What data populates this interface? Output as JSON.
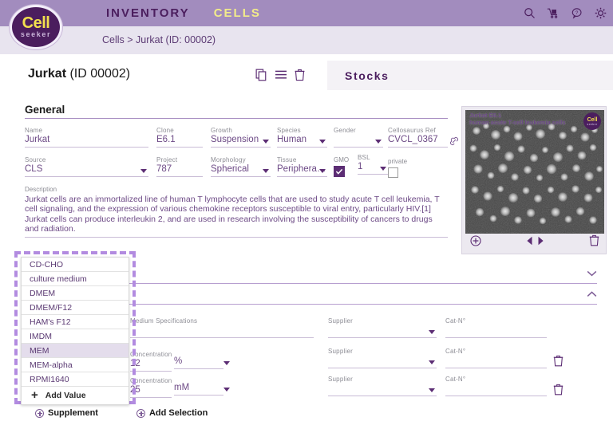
{
  "header": {
    "nav": [
      {
        "label": "INVENTORY",
        "active": false
      },
      {
        "label": "CELLS",
        "active": true
      }
    ],
    "icons": [
      "search-icon",
      "cart-icon",
      "help-icon",
      "gear-icon"
    ],
    "logo": {
      "line1": "Cell",
      "line2": "seeker"
    },
    "breadcrumb": "Cells > Jurkat (ID: 00002)"
  },
  "titlebar": {
    "title_bold": "Jurkat",
    "title_rest": " (ID 00002)",
    "icons": [
      "copy-icon",
      "list-icon",
      "delete-icon"
    ],
    "stocks_tab": "Stocks"
  },
  "general": {
    "section_label": "General",
    "fields": {
      "name": {
        "label": "Name",
        "value": "Jurkat"
      },
      "clone": {
        "label": "Clone",
        "value": "E6.1"
      },
      "growth": {
        "label": "Growth",
        "value": "Suspension"
      },
      "species": {
        "label": "Species",
        "value": "Human"
      },
      "gender": {
        "label": "Gender",
        "value": ""
      },
      "cellosaurus": {
        "label": "Cellosaurus Ref",
        "value": "CVCL_0367"
      },
      "source": {
        "label": "Source",
        "value": "CLS"
      },
      "project": {
        "label": "Project",
        "value": "787"
      },
      "morphology": {
        "label": "Morphology",
        "value": "Spherical"
      },
      "tissue": {
        "label": "Tissue",
        "value": "Peripheral ..."
      },
      "gmo": {
        "label": "GMO",
        "checked": true
      },
      "bsl": {
        "label": "BSL",
        "value": "1"
      },
      "private": {
        "label": "private",
        "checked": false
      }
    },
    "description": {
      "label": "Description",
      "text": "Jurkat cells are an immortalized line of human T lymphocyte cells that are used to study acute T cell leukemia, T cell signaling, and the expression of various chemokine receptors susceptible to viral entry, particularly HIV.[1] Jurkat cells can produce interleukin 2, and are used in research involving the susceptibility of cancers to drugs and radiation."
    }
  },
  "image_panel": {
    "caption_line1": "Jurkat E6.1",
    "caption_line2": "human acute T-cell leukemia cells",
    "badge": {
      "line1": "Cell",
      "line2": "seeker"
    },
    "controls": [
      "add-image-icon",
      "prev-image-icon",
      "next-image-icon",
      "delete-image-icon"
    ]
  },
  "medium": {
    "rows": [
      {
        "spec_label": "Medium Specifications",
        "spec_value": "",
        "supplier_label": "Supplier",
        "supplier_value": "",
        "cat_label": "Cat-N°",
        "cat_value": "",
        "has_delete": false
      },
      {
        "conc_label": "Concentration",
        "conc_value": "12",
        "unit_value": "%",
        "supplier_label": "Supplier",
        "supplier_value": "",
        "cat_label": "Cat-N°",
        "cat_value": "",
        "has_delete": true
      },
      {
        "conc_label": "Concentration",
        "conc_value": "25",
        "unit_value": "mM",
        "supplier_label": "Supplier",
        "supplier_value": "",
        "cat_label": "Cat-N°",
        "cat_value": "",
        "has_delete": true
      }
    ]
  },
  "dropdown": {
    "options": [
      {
        "label": "CD-CHO",
        "selected": false
      },
      {
        "label": "culture medium",
        "selected": false
      },
      {
        "label": "DMEM",
        "selected": false
      },
      {
        "label": "DMEM/F12",
        "selected": false
      },
      {
        "label": "HAM's F12",
        "selected": false
      },
      {
        "label": "IMDM",
        "selected": false
      },
      {
        "label": "MEM",
        "selected": true
      },
      {
        "label": "MEM-alpha",
        "selected": false
      },
      {
        "label": "RPMI1640",
        "selected": false
      }
    ],
    "add_value_label": "Add Value"
  },
  "bottom_actions": {
    "supplement": "Supplement",
    "add_selection": "Add Selection"
  },
  "colors": {
    "topbar": "#a28cbe",
    "brand_dark": "#4b1e5e",
    "accent_yellow": "#f2e04e",
    "field_text": "#6d4a86",
    "label_grey": "#8d8d95",
    "dashed_highlight": "#b28be0"
  }
}
